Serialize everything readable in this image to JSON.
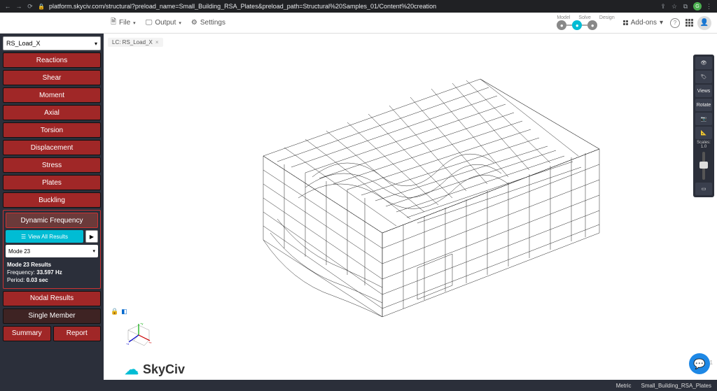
{
  "browser": {
    "url": "platform.skyciv.com/structural?preload_name=Small_Building_RSA_Plates&preload_path=Structural%20Samples_01/Content%20creation",
    "avatar_initial": "G"
  },
  "toolbar": {
    "file": "File",
    "output": "Output",
    "settings": "Settings",
    "pipeline": {
      "model": "Model",
      "solve": "Solve",
      "design": "Design"
    },
    "addons": "Add-ons"
  },
  "sidebar": {
    "load_case": "RS_Load_X",
    "buttons": {
      "reactions": "Reactions",
      "shear": "Shear",
      "moment": "Moment",
      "axial": "Axial",
      "torsion": "Torsion",
      "displacement": "Displacement",
      "stress": "Stress",
      "plates": "Plates",
      "buckling": "Buckling",
      "dynamic_frequency": "Dynamic Frequency",
      "nodal_results": "Nodal Results",
      "single_member": "Single Member",
      "summary": "Summary",
      "report": "Report"
    },
    "dynamic": {
      "view_all": "View All Results",
      "mode_select": "Mode 23",
      "results_title": "Mode 23 Results",
      "freq_label": "Frequency:",
      "freq_val": "33.597 Hz",
      "period_label": "Period:",
      "period_val": "0.03 sec"
    }
  },
  "canvas": {
    "lc_chip": "LC: RS_Load_X",
    "logo_text": "SkyCiv",
    "version": "v6.0.1"
  },
  "right_tools": {
    "views": "Views",
    "rotate": "Rotate",
    "scales": "Scales:",
    "scale_val": "1.0"
  },
  "status": {
    "units": "Metric",
    "filename": "Small_Building_RSA_Plates"
  }
}
